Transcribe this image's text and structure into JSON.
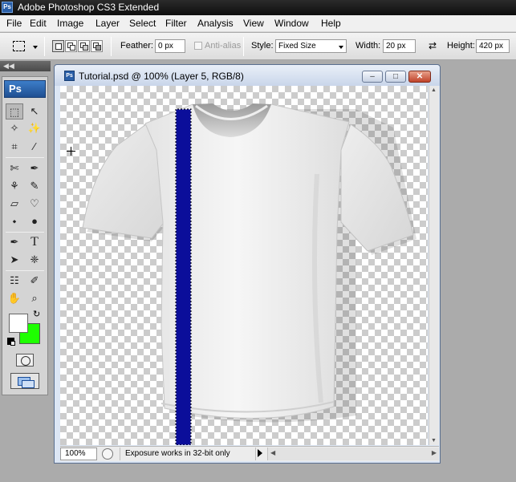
{
  "app": {
    "title": "Adobe Photoshop CS3 Extended",
    "logo_text": "Ps"
  },
  "menu": {
    "items": [
      "File",
      "Edit",
      "Image",
      "Layer",
      "Select",
      "Filter",
      "Analysis",
      "View",
      "Window",
      "Help"
    ]
  },
  "options": {
    "feather_label": "Feather:",
    "feather_value": "0 px",
    "antialias_label": "Anti-alias",
    "style_label": "Style:",
    "style_value": "Fixed Size",
    "width_label": "Width:",
    "width_value": "20 px",
    "swap_icon": "⇄",
    "height_label": "Height:",
    "height_value": "420 px"
  },
  "tools": {
    "badge": "Ps",
    "items": [
      {
        "name": "rectangular-marquee-tool",
        "glyph": "⬚"
      },
      {
        "name": "move-tool",
        "glyph": "↖"
      },
      {
        "name": "lasso-tool",
        "glyph": "✧"
      },
      {
        "name": "magic-wand-tool",
        "glyph": "✨"
      },
      {
        "name": "crop-tool",
        "glyph": "⌗"
      },
      {
        "name": "slice-tool",
        "glyph": "∕"
      },
      {
        "name": "healing-brush-tool",
        "glyph": "✄"
      },
      {
        "name": "brush-tool",
        "glyph": "✒"
      },
      {
        "name": "clone-stamp-tool",
        "glyph": "⚘"
      },
      {
        "name": "history-brush-tool",
        "glyph": "✎"
      },
      {
        "name": "eraser-tool",
        "glyph": "▱"
      },
      {
        "name": "paint-bucket-tool",
        "glyph": "♡"
      },
      {
        "name": "blur-tool",
        "glyph": "⬩"
      },
      {
        "name": "dodge-tool",
        "glyph": "●"
      },
      {
        "name": "pen-tool",
        "glyph": "✒"
      },
      {
        "name": "type-tool",
        "glyph": "T"
      },
      {
        "name": "path-selection-tool",
        "glyph": "➤"
      },
      {
        "name": "custom-shape-tool",
        "glyph": "❈"
      },
      {
        "name": "notes-tool",
        "glyph": "☷"
      },
      {
        "name": "eyedropper-tool",
        "glyph": "✐"
      },
      {
        "name": "hand-tool",
        "glyph": "✋"
      },
      {
        "name": "zoom-tool",
        "glyph": "⌕"
      }
    ],
    "foreground_color": "#ffffff",
    "background_color": "#1eff00"
  },
  "document": {
    "title": "Tutorial.psd @ 100% (Layer 5, RGB/8)",
    "zoom": "100%",
    "status_text": "Exposure works in 32-bit only",
    "stripe_color": "#0b0e9a",
    "shirt_color": "#f3f3f3"
  },
  "window_buttons": {
    "minimize": "‒",
    "maximize": "□",
    "close": "✕"
  }
}
